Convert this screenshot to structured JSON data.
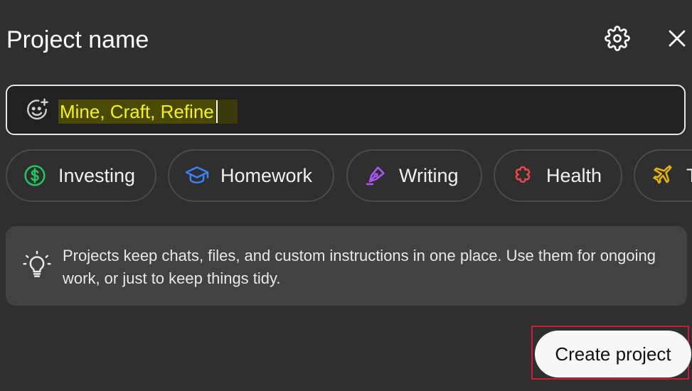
{
  "header": {
    "title": "Project name",
    "settings_icon": "gear-icon",
    "close_icon": "close-icon"
  },
  "name_field": {
    "value": "Mine, Craft, Refine",
    "icon": "emoji-add-icon",
    "highlight_color": "#f4f31a"
  },
  "chips": [
    {
      "label": "Investing",
      "icon": "dollar-circle-icon",
      "color": "#22c55e"
    },
    {
      "label": "Homework",
      "icon": "graduation-cap-icon",
      "color": "#3b82f6"
    },
    {
      "label": "Writing",
      "icon": "pen-nib-icon",
      "color": "#a855f7"
    },
    {
      "label": "Health",
      "icon": "health-flower-icon",
      "color": "#ef4444"
    },
    {
      "label": "T",
      "icon": "airplane-icon",
      "color": "#eab308"
    }
  ],
  "info": {
    "icon": "lightbulb-icon",
    "text": "Projects keep chats, files, and custom instructions in one place. Use them for ongoing work, or just to keep things tidy."
  },
  "actions": {
    "create_label": "Create project",
    "focus_outline_color": "#c8202c"
  }
}
